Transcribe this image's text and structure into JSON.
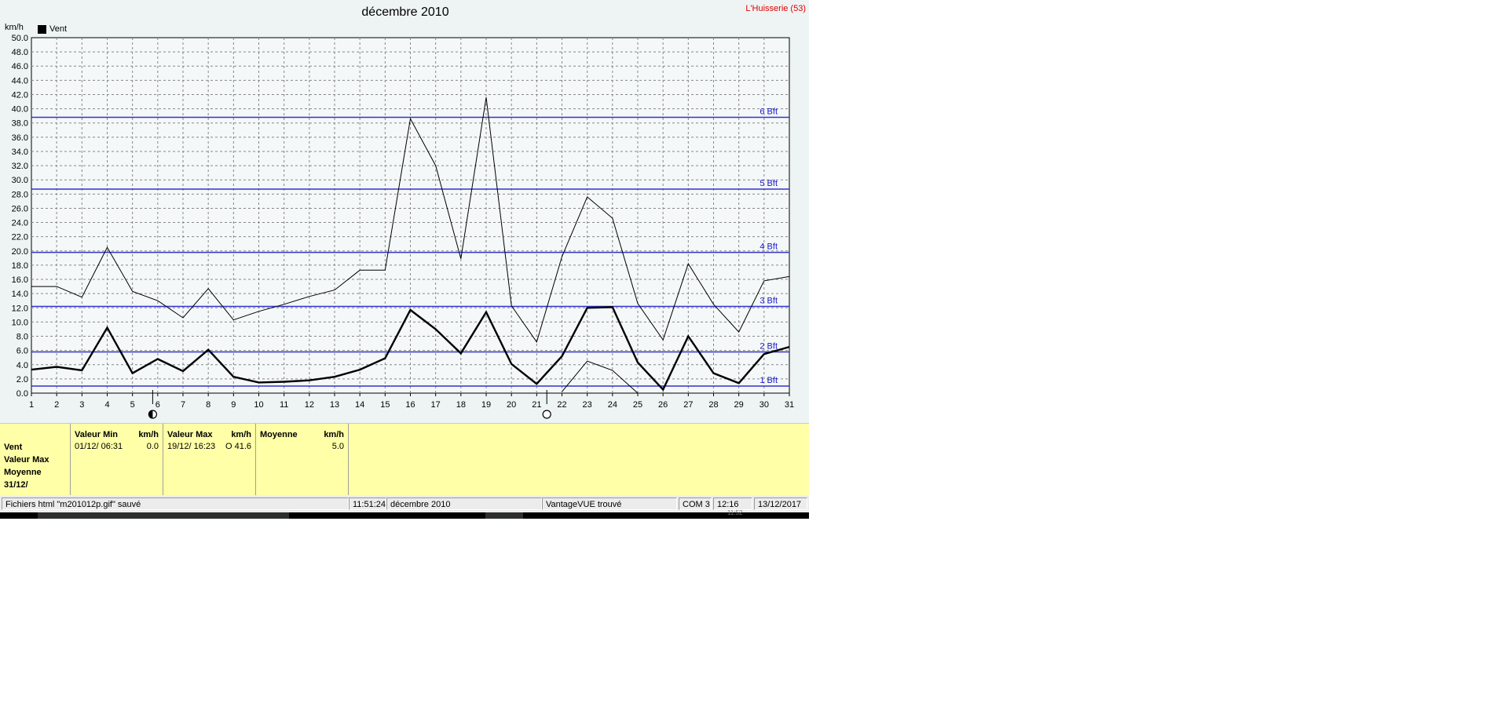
{
  "window": {
    "chart_title": "décembre 2010",
    "station": "L'Huisserie (53)"
  },
  "chart_data": {
    "type": "line",
    "title": "décembre 2010",
    "ylabel": "km/h",
    "ylim": [
      0,
      50
    ],
    "y_ticks": [
      "0.0",
      "2.0",
      "4.0",
      "6.0",
      "8.0",
      "10.0",
      "12.0",
      "14.0",
      "16.0",
      "18.0",
      "20.0",
      "22.0",
      "24.0",
      "26.0",
      "28.0",
      "30.0",
      "32.0",
      "34.0",
      "36.0",
      "38.0",
      "40.0",
      "42.0",
      "44.0",
      "46.0",
      "48.0",
      "50.0"
    ],
    "x": [
      1,
      2,
      3,
      4,
      5,
      6,
      7,
      8,
      9,
      10,
      11,
      12,
      13,
      14,
      15,
      16,
      17,
      18,
      19,
      20,
      21,
      22,
      23,
      24,
      25,
      26,
      27,
      28,
      29,
      30,
      31
    ],
    "grid": true,
    "legend": "top-left",
    "legend_entries": [
      "Vent"
    ],
    "series": [
      {
        "name": "Vent",
        "kind": "average",
        "values": [
          3.3,
          3.7,
          3.2,
          9.2,
          2.8,
          4.8,
          3.1,
          6.1,
          2.3,
          1.5,
          1.6,
          1.8,
          2.3,
          3.3,
          4.9,
          11.7,
          9.0,
          5.6,
          11.4,
          4.1,
          1.3,
          5.2,
          12.0,
          12.1,
          4.3,
          0.5,
          8.0,
          2.8,
          1.4,
          5.5,
          6.5
        ]
      },
      {
        "kind": "max",
        "values": [
          15.0,
          15.0,
          13.5,
          20.5,
          14.3,
          13.0,
          10.6,
          14.7,
          10.3,
          11.5,
          12.5,
          13.6,
          14.5,
          17.3,
          17.3,
          38.6,
          32.0,
          18.9,
          41.6,
          12.3,
          7.2,
          19.2,
          27.6,
          24.6,
          12.6,
          7.5,
          18.2,
          12.5,
          8.6,
          15.8,
          16.4
        ]
      },
      {
        "kind": "min",
        "values": [
          null,
          null,
          null,
          null,
          null,
          null,
          null,
          null,
          null,
          null,
          null,
          null,
          null,
          null,
          null,
          null,
          null,
          null,
          null,
          null,
          null,
          0.2,
          4.5,
          3.2,
          0.0,
          null,
          null,
          null,
          null,
          null,
          null
        ]
      }
    ],
    "beaufort_lines": [
      {
        "label": "1 Bft",
        "value": 1.0
      },
      {
        "label": "2 Bft",
        "value": 5.8
      },
      {
        "label": "3 Bft",
        "value": 12.2
      },
      {
        "label": "4 Bft",
        "value": 19.8
      },
      {
        "label": "5 Bft",
        "value": 28.7
      },
      {
        "label": "6 Bft",
        "value": 38.8
      }
    ],
    "moon_phases": [
      {
        "day": 5.8,
        "phase": "last-quarter"
      },
      {
        "day": 21.4,
        "phase": "full"
      }
    ],
    "colors": {
      "series_line": "#000000",
      "beaufort_line": "#3333cc",
      "beaufort_label": "#1a1acc",
      "grid": "#888888",
      "plot_bg": "#f4f8f8"
    }
  },
  "stats": {
    "row_labels": [
      "Vent",
      "Valeur Max",
      "Moyenne",
      "31/12/"
    ],
    "min_col": {
      "header": "Valeur Min",
      "unit": "km/h",
      "date": "01/12/  06:31",
      "value": "0.0"
    },
    "max_col": {
      "header": "Valeur Max",
      "unit": "km/h",
      "date": "19/12/  16:23",
      "value": "O 41.6"
    },
    "avg_col": {
      "header": "Moyenne",
      "unit": "km/h",
      "value": "5.0"
    }
  },
  "status_bar": {
    "message": "Fichiers html  \"m201012p.gif\"  sauvé",
    "time": "11:51:24",
    "period": "décembre 2010",
    "console": "VantageVUE trouvé",
    "port": "COM 3",
    "clock": "12:16",
    "date": "13/12/2017"
  },
  "taskbar_strip": {
    "fragment": "11:52"
  }
}
